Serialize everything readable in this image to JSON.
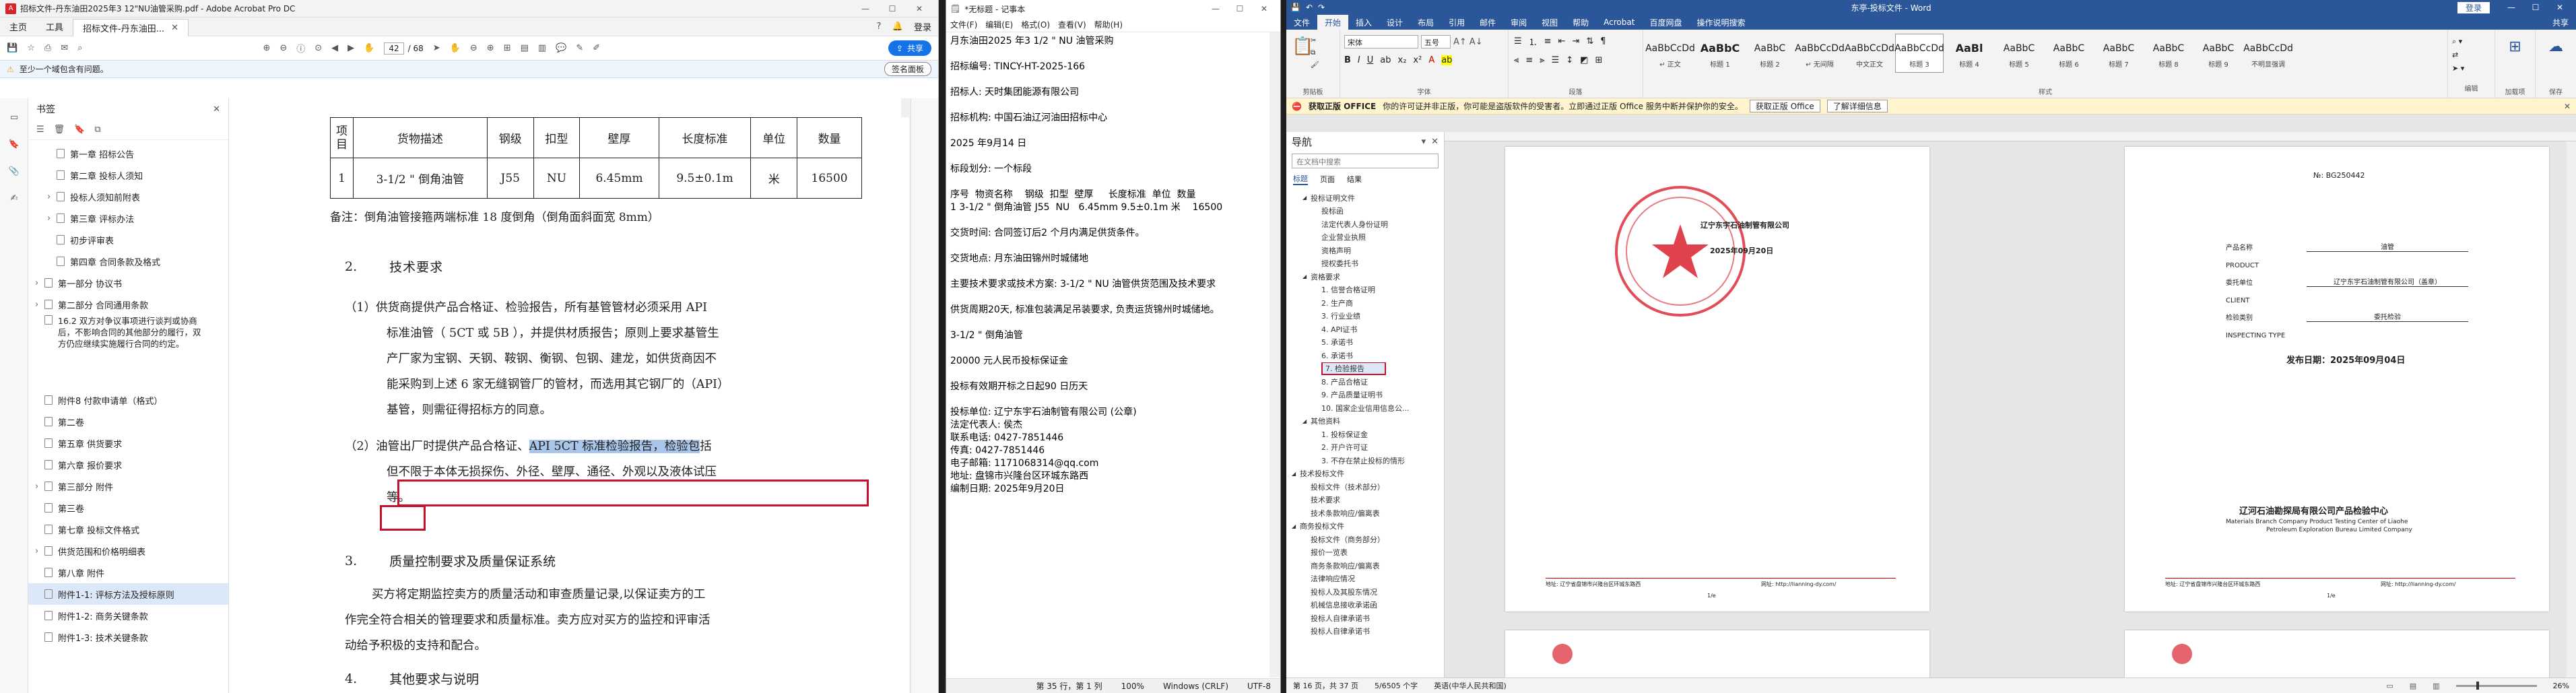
{
  "pdf": {
    "title": "招标文件-丹东油田2025年3 12\"NU油管采购.pdf - Adobe Acrobat Pro DC",
    "menus": [
      "主页",
      "工具"
    ],
    "doc_tab": "招标文件-丹东油田...",
    "page_current": "42",
    "page_total": "/ 68",
    "share": "共享",
    "sign_in": "登录",
    "notice": "至少一个域包含有问题。",
    "notice_btn": "签名面板",
    "bookmarks_title": "书签",
    "bookmarks": [
      {
        "label": "第一章 招标公告",
        "indent": 1,
        "exp": ""
      },
      {
        "label": "第二章 投标人须知",
        "indent": 1,
        "exp": ""
      },
      {
        "label": "投标人须知前附表",
        "indent": 1,
        "exp": "›"
      },
      {
        "label": "第三章 评标办法",
        "indent": 1,
        "exp": "›"
      },
      {
        "label": "初步评审表",
        "indent": 1,
        "exp": ""
      },
      {
        "label": "第四章 合同条款及格式",
        "indent": 1,
        "exp": ""
      },
      {
        "label": "第一部分 协议书",
        "indent": 0,
        "exp": "›"
      },
      {
        "label": "第二部分 合同通用条款",
        "indent": 0,
        "exp": "›"
      },
      {
        "label": "16.2 双方对争议事项进行谈判或协商后，不影响合同的其他部分的履行，双方仍应继续实施履行合同的约定。",
        "indent": 0,
        "exp": "",
        "multi": true
      },
      {
        "label": "附件8 付款申请单（格式）",
        "indent": 0,
        "exp": ""
      },
      {
        "label": "第二卷",
        "indent": 0,
        "exp": ""
      },
      {
        "label": "第五章 供货要求",
        "indent": 0,
        "exp": ""
      },
      {
        "label": "第六章 报价要求",
        "indent": 0,
        "exp": ""
      },
      {
        "label": "第三部分 附件",
        "indent": 0,
        "exp": "›"
      },
      {
        "label": "第三卷",
        "indent": 0,
        "exp": ""
      },
      {
        "label": "第七章 投标文件格式",
        "indent": 0,
        "exp": ""
      },
      {
        "label": "供货范围和价格明细表",
        "indent": 0,
        "exp": "›"
      },
      {
        "label": "第八章 附件",
        "indent": 0,
        "exp": ""
      },
      {
        "label": "附件1-1: 评标方法及授标原则",
        "indent": 0,
        "exp": "",
        "hl": true
      },
      {
        "label": "附件1-2: 商务关键条款",
        "indent": 0,
        "exp": ""
      },
      {
        "label": "附件1-3: 技术关键条款",
        "indent": 0,
        "exp": ""
      }
    ],
    "table_head": [
      "项目",
      "货物描述",
      "钢级",
      "扣型",
      "壁厚",
      "长度标准",
      "单位",
      "数量"
    ],
    "table_row": [
      "1",
      "3-1/2 \" 倒角油管",
      "J55",
      "NU",
      "6.45mm",
      "9.5±0.1m",
      "米",
      "16500"
    ],
    "note": "备注：倒角油管接箍两端标准 18 度倒角（倒角面斜面宽 8mm）",
    "sec2_num": "2.",
    "sec2_title": "技术要求",
    "p1_lines": [
      "（1）供货商提供产品合格证、检验报告，所有基管管材必须采用 API",
      "标准油管（ 5CT 或 5B ），并提供材质报告；原则上要求基管生",
      "产厂家为宝钢、天钢、鞍钢、衡钢、包钢、建龙，如供货商因不",
      "能采购到上述 6 家无缝钢管厂的管材，而选用其它钢厂的（API）",
      "基管，则需征得招标方的同意。"
    ],
    "p2_pre": "（2）油管出厂时提供产品合格证、",
    "p2_hl": "API 5CT 标准检验报告，检验包",
    "p2_post": "括",
    "p2_line2": "但不限于本体无损探伤、外径、壁厚、通径、外观以及液体试压",
    "p2_line3": "等。",
    "sec3_num": "3.",
    "sec3_title": "质量控制要求及质量保证系统",
    "p3_lines": [
      "买方将定期监控卖方的质量活动和审查质量记录,以保证卖方的工",
      "作完全符合相关的管理要求和质量标准。卖方应对买方的监控和评审活",
      "动给予积极的支持和配合。"
    ],
    "sec4_num": "4.",
    "sec4_title": "其他要求与说明"
  },
  "notepad": {
    "title": "*无标题 - 记事本",
    "menus": [
      "文件(F)",
      "编辑(E)",
      "格式(O)",
      "查看(V)",
      "帮助(H)"
    ],
    "lines": [
      "月东油田2025 年3 1/2 \" NU 油管采购",
      "",
      "招标编号: TINCY-HT-2025-166",
      "",
      "招标人: 天时集团能源有限公司",
      "",
      "招标机构: 中国石油辽河油田招标中心",
      "",
      "2025 年9月14 日",
      "",
      "标段划分: 一个标段",
      "",
      "序号  物资名称    钢级  扣型  壁厚     长度标准  单位  数量",
      "1 3-1/2 \" 倒角油管 J55  NU   6.45mm 9.5±0.1m 米    16500",
      "",
      "交货时间: 合同签订后2 个月内满足供货条件。",
      "",
      "交货地点: 月东油田锦州时城储地",
      "",
      "主要技术要求或技术方案: 3-1/2 \" NU 油管供货范围及技术要求",
      "",
      "供货周期20天, 标准包装满足吊装要求, 负责运货锦州时城储地。",
      "",
      "3-1/2 \" 倒角油管",
      "",
      "20000 元人民币投标保证金",
      "",
      "投标有效期开标之日起90 日历天",
      "",
      "投标单位: 辽宁东宇石油制管有限公司 (公章)",
      "法定代表人: 侯杰",
      "联系电话: 0427-7851446",
      "传真: 0427-7851446",
      "电子邮箱: 1171068314@qq.com",
      "地址: 盘锦市兴隆台区环城东路西",
      "编制日期: 2025年9月20日"
    ],
    "status": [
      "第 35 行，第 1 列",
      "100%",
      "Windows (CRLF)",
      "UTF-8"
    ]
  },
  "word": {
    "title": "东亭-投标文件 - Word",
    "signin": "登录",
    "tabs": [
      "文件",
      "开始",
      "插入",
      "设计",
      "布局",
      "引用",
      "邮件",
      "审阅",
      "视图",
      "帮助",
      "Acrobat",
      "百度网盘",
      "操作说明搜索"
    ],
    "share": "共享",
    "font_name": "宋体",
    "font_size": "五号",
    "styles": [
      {
        "sample": "AaBbCcDd",
        "name": "↵ 正文"
      },
      {
        "sample": "AaBbC",
        "name": "标题 1"
      },
      {
        "sample": "AaBbC",
        "name": "标题 2"
      },
      {
        "sample": "AaBbCcDd",
        "name": "↵ 无间隔"
      },
      {
        "sample": "AaBbCcDd",
        "name": "中文正文"
      },
      {
        "sample": "AaBbCcDd",
        "name": "标题 3"
      },
      {
        "sample": "AaBl",
        "name": "标题 4"
      },
      {
        "sample": "AaBbC",
        "name": "标题 5"
      },
      {
        "sample": "AaBbC",
        "name": "标题 6"
      },
      {
        "sample": "AaBbC",
        "name": "标题 7"
      },
      {
        "sample": "AaBbC",
        "name": "标题 8"
      },
      {
        "sample": "AaBbC",
        "name": "标题 9"
      },
      {
        "sample": "AaBbCcDd",
        "name": "不明显强调"
      }
    ],
    "group_labels": [
      "剪贴板",
      "字体",
      "段落",
      "样式",
      "编辑",
      "加载项",
      "保存"
    ],
    "msg_title": "获取正版 OFFICE",
    "msg_text": "你的许可证并非正版，你可能是盗版软件的受害者。立即通过正版 Office 服务中断并保护你的安全。",
    "msg_btn1": "获取正版 Office",
    "msg_btn2": "了解详细信息",
    "nav_title": "导航",
    "nav_search": "在文档中搜索",
    "nav_tabs": [
      "标题",
      "页面",
      "结果"
    ],
    "nav_items": [
      {
        "t": "投标证明文件",
        "i": 1,
        "e": "◢"
      },
      {
        "t": "投标函",
        "i": 2,
        "e": ""
      },
      {
        "t": "法定代表人身份证明",
        "i": 2,
        "e": ""
      },
      {
        "t": "企业营业执照",
        "i": 2,
        "e": ""
      },
      {
        "t": "资格声明",
        "i": 2,
        "e": ""
      },
      {
        "t": "授权委托书",
        "i": 2,
        "e": ""
      },
      {
        "t": "资格要求",
        "i": 1,
        "e": "◢"
      },
      {
        "t": "1. 信誉合格证明",
        "i": 2,
        "e": ""
      },
      {
        "t": "2. 生产商",
        "i": 2,
        "e": ""
      },
      {
        "t": "3. 行业业绩",
        "i": 2,
        "e": ""
      },
      {
        "t": "4. API证书",
        "i": 2,
        "e": ""
      },
      {
        "t": "5. 承诺书",
        "i": 2,
        "e": ""
      },
      {
        "t": "6. 承诺书",
        "i": 2,
        "e": ""
      },
      {
        "t": "7. 检验报告",
        "i": 2,
        "e": "",
        "sel": true
      },
      {
        "t": "8. 产品合格证",
        "i": 2,
        "e": ""
      },
      {
        "t": "9. 产品质量证明书",
        "i": 2,
        "e": ""
      },
      {
        "t": "10. 国家企业信用信息公...",
        "i": 2,
        "e": ""
      },
      {
        "t": "其他资料",
        "i": 1,
        "e": "◢"
      },
      {
        "t": "1. 投标保证金",
        "i": 2,
        "e": ""
      },
      {
        "t": "2. 开户许可证",
        "i": 2,
        "e": ""
      },
      {
        "t": "3. 不存在禁止投标的情形",
        "i": 2,
        "e": ""
      },
      {
        "t": "技术投标文件",
        "i": 0,
        "e": "◢"
      },
      {
        "t": "投标文件（技术部分）",
        "i": 1,
        "e": ""
      },
      {
        "t": "技术要求",
        "i": 1,
        "e": ""
      },
      {
        "t": "技术条款响应/偏离表",
        "i": 1,
        "e": ""
      },
      {
        "t": "商务投标文件",
        "i": 0,
        "e": "◢"
      },
      {
        "t": "投标文件（商务部分）",
        "i": 1,
        "e": ""
      },
      {
        "t": "报价一览表",
        "i": 1,
        "e": ""
      },
      {
        "t": "商务条款响应/偏离表",
        "i": 1,
        "e": ""
      },
      {
        "t": "法律响应情况",
        "i": 1,
        "e": ""
      },
      {
        "t": "投标人及其股东情况",
        "i": 1,
        "e": ""
      },
      {
        "t": "机械信息接收承诺函",
        "i": 1,
        "e": ""
      },
      {
        "t": "投标人自律承诺书",
        "i": 1,
        "e": ""
      },
      {
        "t": "投标人自律承诺书",
        "i": 1,
        "e": ""
      }
    ],
    "p1_company": "辽宁东宇石油制管有限公司",
    "p1_date": "2025年09月20日",
    "footer_left": "地址: 辽宁省盘锦市兴隆台区环城东路西",
    "footer_right": "网址: http://lianning-dy.com/",
    "p2_no": "№: BG250442",
    "p2_fields": [
      {
        "k": "产品名称",
        "v": "油管"
      },
      {
        "k": "PRODUCT",
        "v": ""
      },
      {
        "k": "委托单位",
        "v": "辽宁东宇石油制管有限公司（盖章）"
      },
      {
        "k": "CLIENT",
        "v": ""
      },
      {
        "k": "检验类别",
        "v": "委托检验"
      },
      {
        "k": "INSPECTING TYPE",
        "v": ""
      }
    ],
    "p2_date": "发布日期：2025年09月04日",
    "p2_org_cn": "辽河石油勘探局有限公司产品检验中心",
    "p2_org_en1": "Materials Branch Company Product Testing Center of Liaohe",
    "p2_org_en2": "Petroleum Exploration Bureau Limited Company",
    "page_marks": [
      "1/e",
      "1/e"
    ],
    "status": [
      "第 16 页，共 37 页",
      "5/6505 个字",
      "英语(中华人民共和国)"
    ],
    "zoom": "26%"
  }
}
